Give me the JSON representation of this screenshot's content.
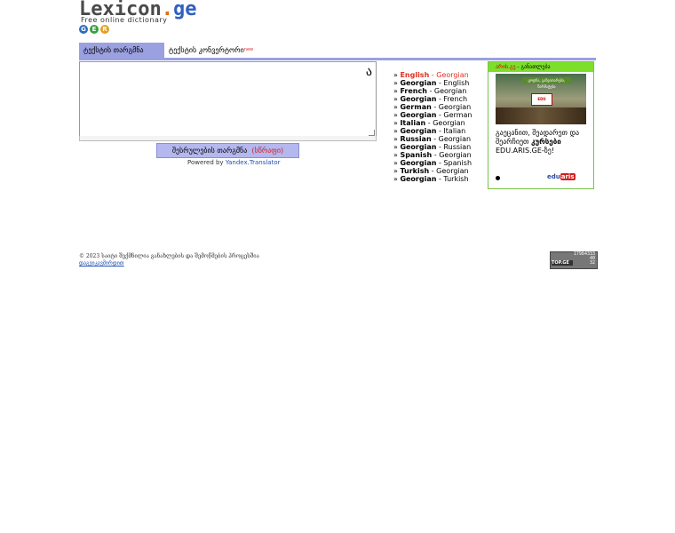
{
  "logo": {
    "part1": "Lexicon",
    "dot": ".",
    "part2": "ge",
    "tagline": "Free online dictionary"
  },
  "flags": [
    "G",
    "E",
    "R"
  ],
  "tabs": [
    {
      "label": "ტექსტის თარგმნა"
    },
    {
      "label": "ტექსტის კონვერტორი",
      "badge": "new"
    }
  ],
  "translator": {
    "textarea_value": "",
    "translit_icon": "transliteration-icon",
    "button_label": "შესრულების თარგმნა",
    "button_fast": "(სწრაფი)",
    "powered_prefix": "Powered by",
    "powered_link": "Yandex.Translator"
  },
  "languages": [
    {
      "from": "English",
      "to": "Georgian",
      "current": true
    },
    {
      "from": "Georgian",
      "to": "English"
    },
    {
      "from": "French",
      "to": "Georgian"
    },
    {
      "from": "Georgian",
      "to": "French"
    },
    {
      "from": "German",
      "to": "Georgian"
    },
    {
      "from": "Georgian",
      "to": "German"
    },
    {
      "from": "Italian",
      "to": "Georgian"
    },
    {
      "from": "Georgian",
      "to": "Italian"
    },
    {
      "from": "Russian",
      "to": "Georgian"
    },
    {
      "from": "Georgian",
      "to": "Russian"
    },
    {
      "from": "Spanish",
      "to": "Georgian"
    },
    {
      "from": "Georgian",
      "to": "Spanish"
    },
    {
      "from": "Turkish",
      "to": "Georgian"
    },
    {
      "from": "Georgian",
      "to": "Turkish"
    }
  ],
  "ad": {
    "head_site": "არის.გე",
    "head_rest": " - განათლება",
    "banner_text": "ცოდნა, განვითარება, წარმატება",
    "screen_text": "EDU",
    "line1": "გაეცანით, შეადარეთ და",
    "line2_pre": "შეარჩიეთ ",
    "line2_bold": "კურსები",
    "line3": "EDU.ARIS.GE-ზე!",
    "logo_edu": "edu",
    "logo_aris": "aris"
  },
  "footer": {
    "copyright": "© 2023 საიტი შექმნილია განახლების და შემოწმების პროცესშია",
    "link": "დაგვიკავშირდით"
  },
  "counter": {
    "line1": "17984333",
    "line2": "40",
    "line3": "32",
    "brand": "TOP.GE"
  },
  "colors": {
    "tab_active": "#9aa0e0",
    "button_bg": "#b4b8ef",
    "ad_border": "#79c24a",
    "ad_head": "#7ce02a",
    "lang_current": "#e03020"
  }
}
